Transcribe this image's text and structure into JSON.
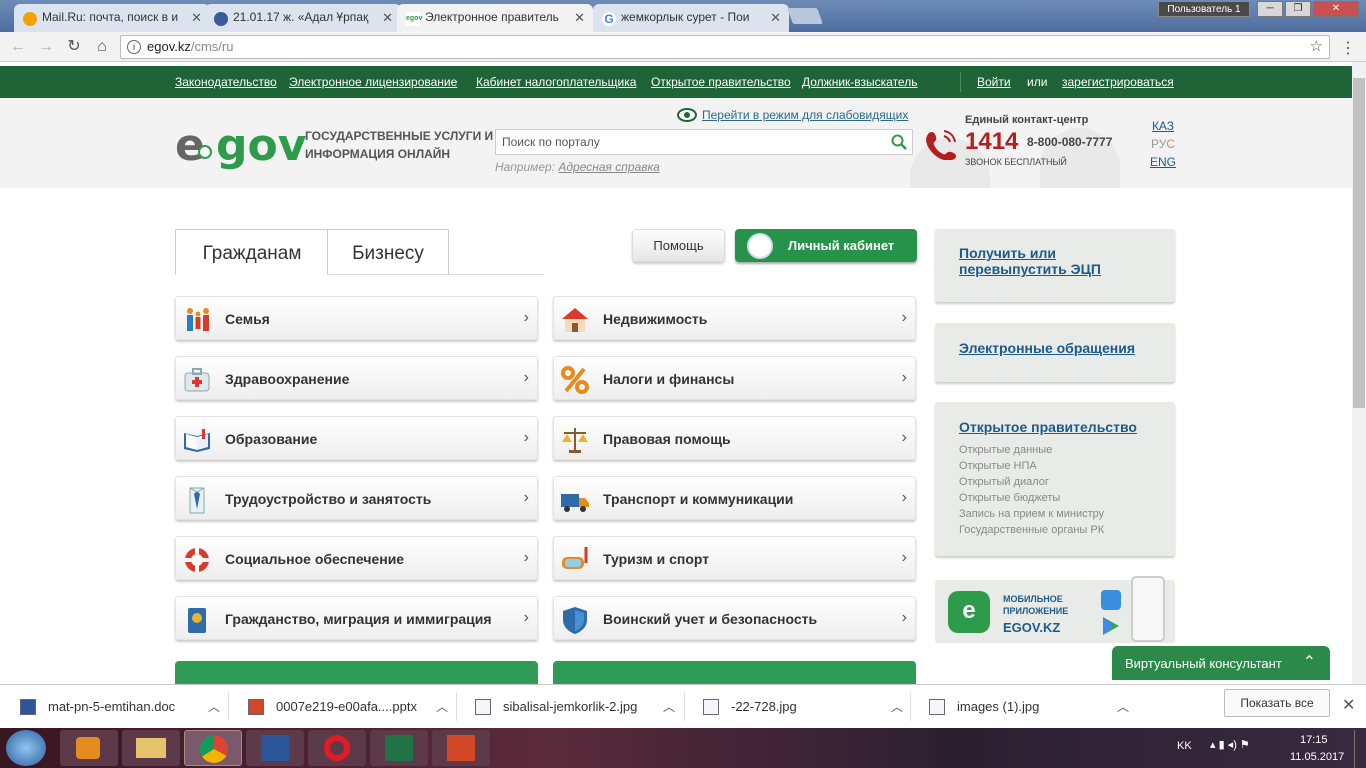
{
  "browser": {
    "tabs": [
      {
        "title": "Mail.Ru: почта, поиск в и",
        "favicon_color": "#f2a200"
      },
      {
        "title": "21.01.17 ж. «Адал Ұрпақ",
        "favicon_color": "#3b5a9a"
      },
      {
        "title": "Электронное правитель",
        "favicon_color": "#2e9b4a",
        "favicon_text": "egov"
      },
      {
        "title": "жемкорлык сурет - Пои",
        "favicon_color": "#4285f4",
        "favicon_text": "G"
      }
    ],
    "user": "Пользователь 1",
    "url_host": "egov.kz",
    "url_path": "/cms/ru"
  },
  "topnav": {
    "links": [
      "Законодательство",
      "Электронное лицензирование",
      "Кабинет налогоплательщика",
      "Открытое правительство",
      "Должник-взыскатель"
    ],
    "login": "Войти",
    "or": "или",
    "register": "зарегистрироваться"
  },
  "header": {
    "logo_e": "e",
    "logo_gov": "gov",
    "tagline": "ГОСУДАРСТВЕННЫЕ УСЛУГИ И ИНФОРМАЦИЯ ОНЛАЙН",
    "low_vision": "Перейти в режим для слабовидящих",
    "search_placeholder": "Поиск по порталу",
    "example_label": "Например:",
    "example_link": "Адресная справка",
    "contact_title": "Единый контакт-центр",
    "contact_short": "1414",
    "contact_long": "8-800-080-7777",
    "contact_free": "ЗВОНОК БЕСПЛАТНЫЙ",
    "langs": [
      "КАЗ",
      "РУС",
      "ENG"
    ]
  },
  "main": {
    "tabs": [
      "Гражданам",
      "Бизнесу"
    ],
    "help": "Помощь",
    "cabinet": "Личный кабинет",
    "categories_left": [
      "Семья",
      "Здравоохранение",
      "Образование",
      "Трудоустройство и занятость",
      "Социальное обеспечение",
      "Гражданство, миграция и иммиграция"
    ],
    "categories_right": [
      "Недвижимость",
      "Налоги и финансы",
      "Правовая помощь",
      "Транспорт и коммуникации",
      "Туризм и спорт",
      "Воинский учет и безопасность"
    ]
  },
  "sidebar": {
    "ecp": "Получить или перевыпустить ЭЦП",
    "appeals": "Электронные обращения",
    "open_gov": "Открытое правительство",
    "open_gov_items": [
      "Открытые данные",
      "Открытые НПА",
      "Открытый диалог",
      "Открытые бюджеты",
      "Запись на прием к министру",
      "Государственные органы РК"
    ],
    "mobile_l1": "МОБИЛЬНОЕ",
    "mobile_l2": "ПРИЛОЖЕНИЕ",
    "mobile_l3": "EGOV.KZ"
  },
  "virtual_consultant": "Виртуальный консультант",
  "downloads": {
    "items": [
      "mat-pn-5-emtihan.doc",
      "0007e219-e00afa....pptx",
      "sibalisal-jemkorlik-2.jpg",
      "-22-728.jpg",
      "images (1).jpg"
    ],
    "show_all": "Показать все"
  },
  "taskbar": {
    "lang": "KK",
    "time": "17:15",
    "date": "11.05.2017"
  }
}
